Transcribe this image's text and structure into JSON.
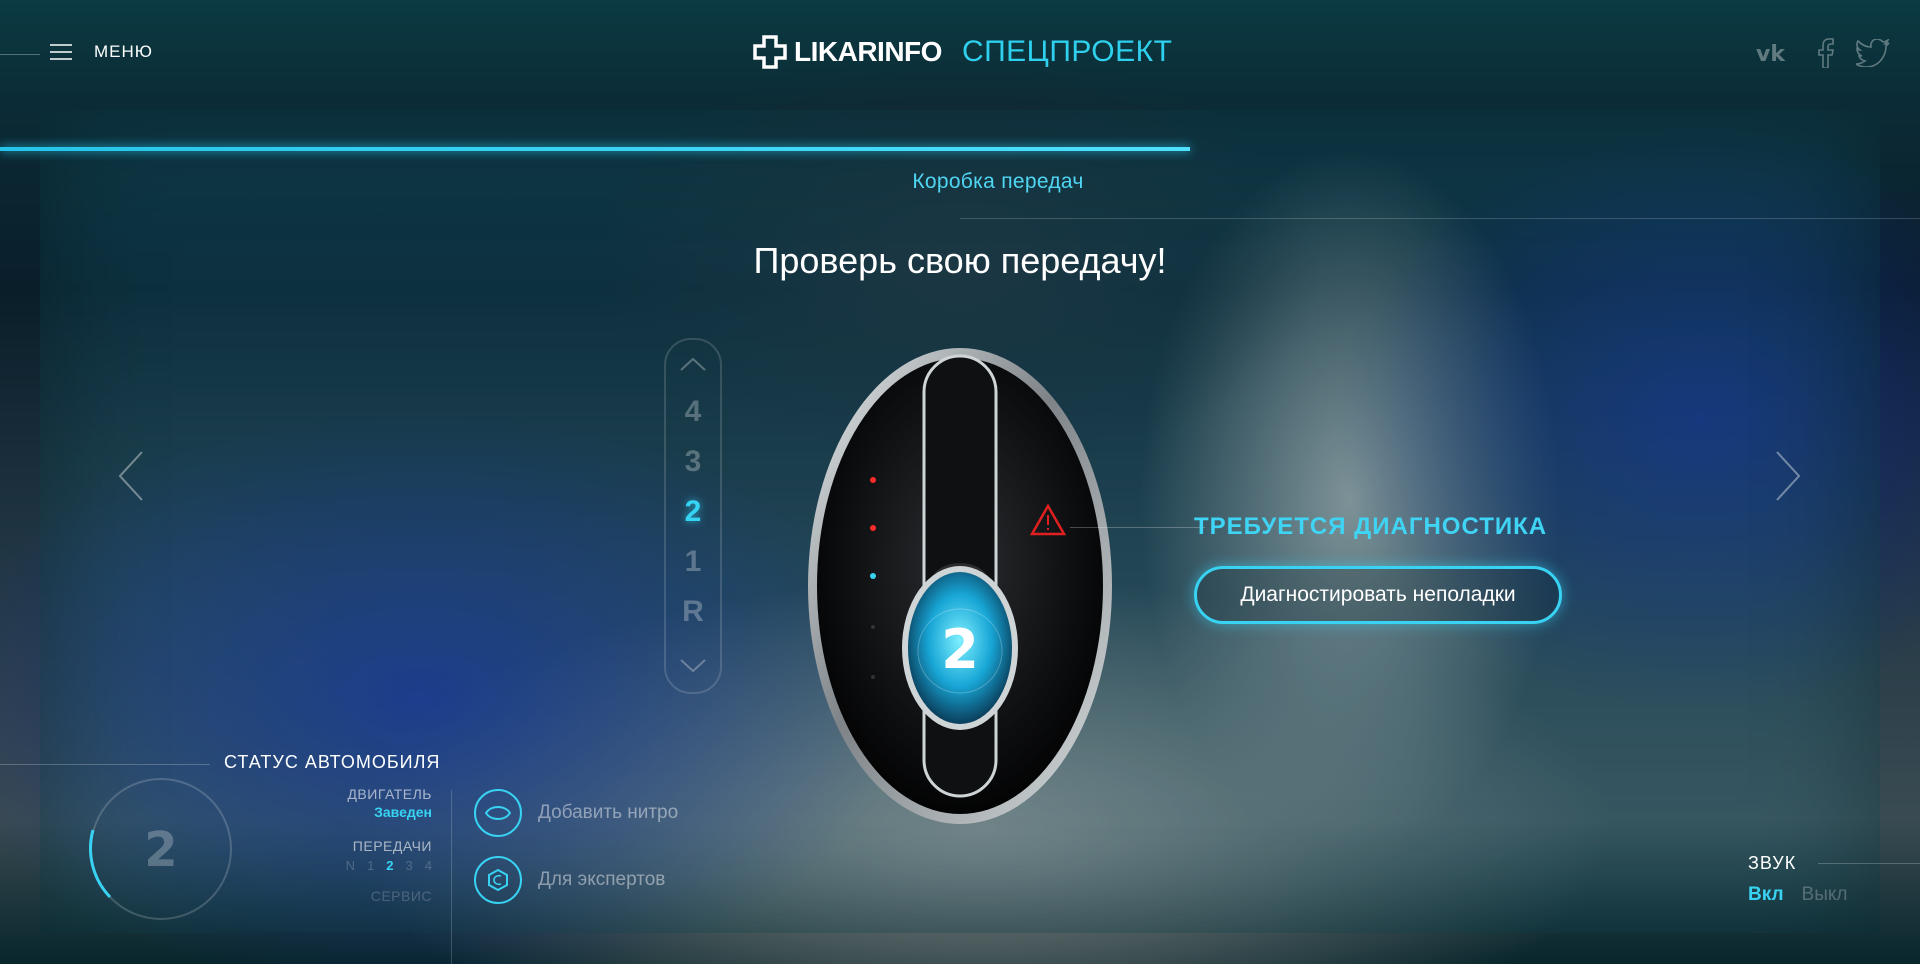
{
  "header": {
    "menu_label": "МЕНЮ",
    "logo_brand": "LIKARINFO",
    "logo_sub": "СПЕЦПРОЕКТ",
    "social": [
      "vk-icon",
      "facebook-icon",
      "twitter-icon"
    ]
  },
  "progress": {
    "value": 0.62
  },
  "section": {
    "title": "Коробка передач"
  },
  "headline": "Проверь свою передачу!",
  "gear_selector": {
    "gears": [
      "4",
      "3",
      "2",
      "1",
      "R"
    ],
    "active": "2"
  },
  "shifter": {
    "current_gear": "2"
  },
  "diagnostics": {
    "title": "ТРЕБУЕТСЯ ДИАГНОСТИКА",
    "button_label": "Диагностировать неполадки"
  },
  "status": {
    "title": "СТАТУС АВТОМОБИЛЯ",
    "gauge_value": "2",
    "engine_label": "ДВИГАТЕЛЬ",
    "engine_value": "Заведен",
    "gears_label": "ПЕРЕДАЧИ",
    "gears": [
      "N",
      "1",
      "2",
      "3",
      "4"
    ],
    "active_gear": "2",
    "service_label": "СЕРВИС"
  },
  "options": [
    {
      "label": "Добавить нитро",
      "icon": "nitro-icon"
    },
    {
      "label": "Для экспертов",
      "icon": "expert-icon"
    }
  ],
  "sound": {
    "title": "ЗВУК",
    "on_label": "Вкл",
    "off_label": "Выкл"
  },
  "colors": {
    "accent": "#38d2f2",
    "warning": "#e02020"
  }
}
